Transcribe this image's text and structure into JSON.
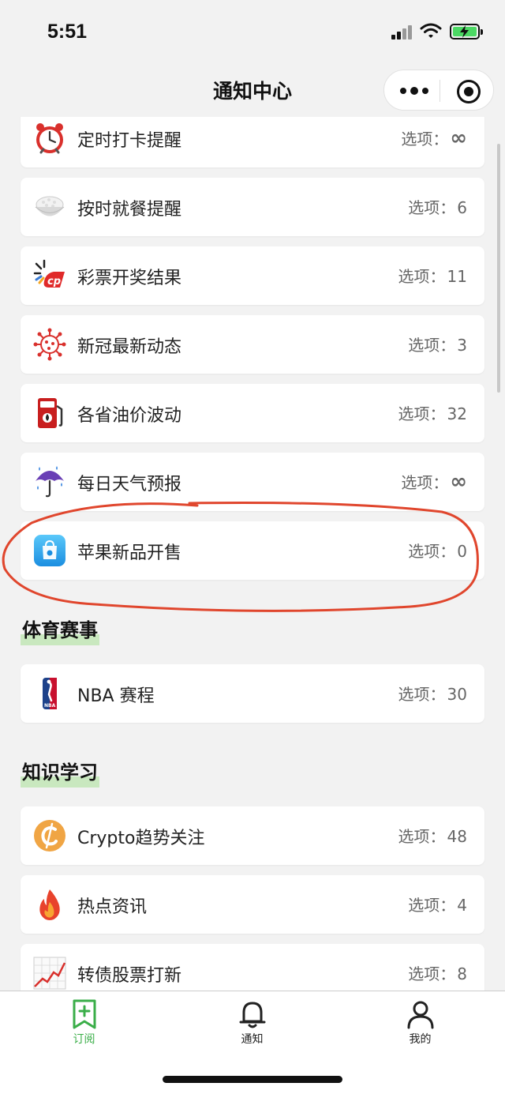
{
  "status": {
    "time": "5:51"
  },
  "nav": {
    "title": "通知中心"
  },
  "option_prefix": "选项：",
  "cards": [
    {
      "name": "定时打卡提醒",
      "value": "∞",
      "icon": "alarm-clock-icon"
    },
    {
      "name": "按时就餐提醒",
      "value": "6",
      "icon": "rice-bowl-icon"
    },
    {
      "name": "彩票开奖结果",
      "value": "11",
      "icon": "lottery-icon"
    },
    {
      "name": "新冠最新动态",
      "value": "3",
      "icon": "virus-icon"
    },
    {
      "name": "各省油价波动",
      "value": "32",
      "icon": "fuel-pump-icon"
    },
    {
      "name": "每日天气预报",
      "value": "∞",
      "icon": "umbrella-rain-icon"
    },
    {
      "name": "苹果新品开售",
      "value": "0",
      "icon": "app-store-bag-icon"
    }
  ],
  "sections": [
    {
      "title": "体育赛事",
      "cards": [
        {
          "name": "NBA 赛程",
          "value": "30",
          "icon": "nba-logo-icon"
        }
      ]
    },
    {
      "title": "知识学习",
      "cards": [
        {
          "name": "Crypto趋势关注",
          "value": "48",
          "icon": "crypto-coin-icon"
        },
        {
          "name": "热点资讯",
          "value": "4",
          "icon": "fire-icon"
        },
        {
          "name": "转债股票打新",
          "value": "8",
          "icon": "stock-chart-icon"
        }
      ]
    }
  ],
  "tabbar": [
    {
      "label": "订阅",
      "icon": "subscribe-bookmark-icon",
      "active": true
    },
    {
      "label": "通知",
      "icon": "bell-icon",
      "active": false
    },
    {
      "label": "我的",
      "icon": "person-icon",
      "active": false
    }
  ],
  "colors": {
    "accent": "#3aae48",
    "annotation": "#e0462d",
    "highlight": "#c9e8bf"
  }
}
